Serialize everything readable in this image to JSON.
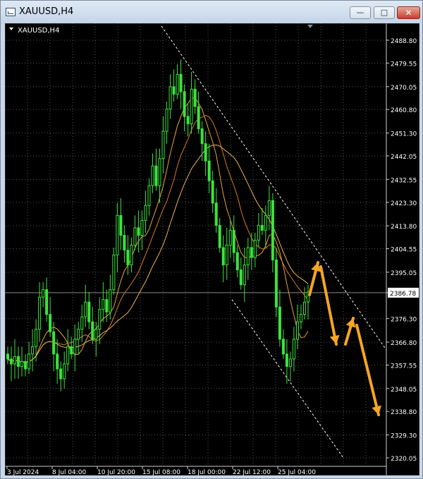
{
  "window": {
    "title": "XAUUSD,H4",
    "buttons": {
      "minimize": "—",
      "maximize": "□",
      "close": "✕"
    }
  },
  "chart_data": {
    "type": "candlestick",
    "symbol_label": "XAUUSD,H4",
    "y_ticks": [
      2488.8,
      2479.55,
      2470.05,
      2460.8,
      2451.3,
      2442.05,
      2432.55,
      2423.3,
      2413.8,
      2404.55,
      2395.05,
      2386.78,
      2376.3,
      2366.8,
      2357.55,
      2348.05,
      2338.8,
      2329.3,
      2320.05
    ],
    "y_tick_labels": [
      "2488.80",
      "2479.55",
      "2470.05",
      "2460.80",
      "2451.30",
      "2442.05",
      "2432.55",
      "2423.30",
      "2413.80",
      "2404.55",
      "2395.05",
      "2386.78",
      "2376.30",
      "2366.80",
      "2357.55",
      "2348.05",
      "2338.80",
      "2329.30",
      "2320.05"
    ],
    "current_price": 2386.78,
    "x_labels": [
      "3 Jul 2024",
      "8 Jul 04:00",
      "10 Jul 20:00",
      "15 Jul 08:00",
      "18 Jul 00:00",
      "22 Jul 12:00",
      "25 Jul 04:00"
    ],
    "price_path": [
      2360,
      2358,
      2361,
      2357,
      2359,
      2356,
      2362,
      2365,
      2372,
      2385,
      2388,
      2378,
      2371,
      2362,
      2356,
      2352,
      2358,
      2365,
      2362,
      2368,
      2372,
      2377,
      2383,
      2375,
      2368,
      2372,
      2380,
      2384,
      2379,
      2388,
      2402,
      2418,
      2410,
      2404,
      2398,
      2406,
      2413,
      2410,
      2416,
      2422,
      2430,
      2438,
      2430,
      2441,
      2452,
      2461,
      2470,
      2467,
      2475,
      2468,
      2458,
      2455,
      2469,
      2462,
      2453,
      2447,
      2440,
      2432,
      2423,
      2414,
      2405,
      2398,
      2406,
      2412,
      2403,
      2396,
      2390,
      2398,
      2405,
      2401,
      2408,
      2414,
      2412,
      2418,
      2424,
      2400,
      2381,
      2368,
      2362,
      2357,
      2360,
      2368,
      2375,
      2378,
      2383,
      2387
    ],
    "moving_average_colors": [
      "#e8a33a",
      "#d97b1f",
      "#f0b25a"
    ],
    "annotation_color": "#f5a623",
    "candle_color": "#3be33b",
    "grid": true
  }
}
